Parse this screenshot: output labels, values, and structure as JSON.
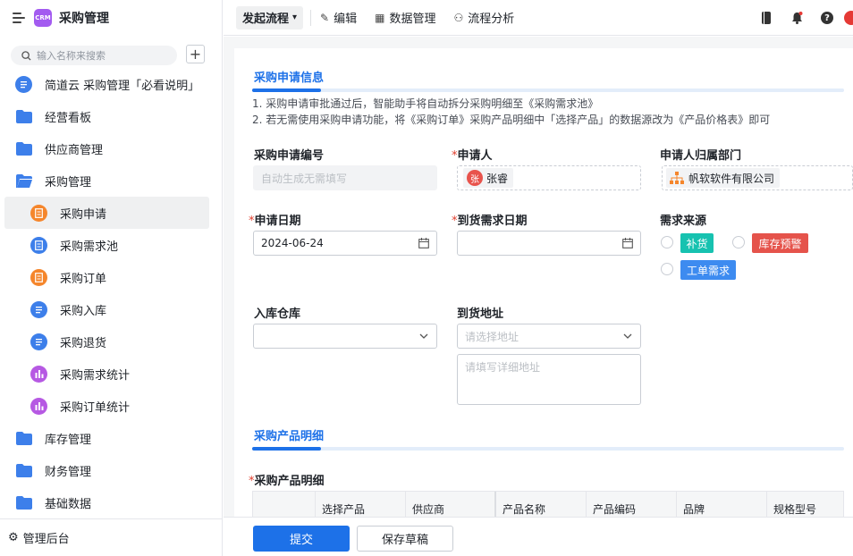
{
  "app": {
    "name": "采购管理",
    "logo_text": "CRM"
  },
  "sidebar": {
    "search_placeholder": "输入名称来搜索",
    "add_label": "+",
    "items": [
      {
        "label": "简道云 采购管理「必看说明」",
        "icon": "doc-icon"
      },
      {
        "label": "经营看板",
        "icon": "folder-icon"
      },
      {
        "label": "供应商管理",
        "icon": "folder-icon"
      },
      {
        "label": "采购管理",
        "icon": "folder-open-icon"
      },
      {
        "label": "采购申请",
        "icon": "form-icon"
      },
      {
        "label": "采购需求池",
        "icon": "form-icon"
      },
      {
        "label": "采购订单",
        "icon": "form-icon"
      },
      {
        "label": "采购入库",
        "icon": "form-icon"
      },
      {
        "label": "采购退货",
        "icon": "form-icon"
      },
      {
        "label": "采购需求统计",
        "icon": "chart-icon"
      },
      {
        "label": "采购订单统计",
        "icon": "chart-icon"
      },
      {
        "label": "库存管理",
        "icon": "folder-icon"
      },
      {
        "label": "财务管理",
        "icon": "folder-icon"
      },
      {
        "label": "基础数据",
        "icon": "folder-icon"
      }
    ],
    "footer": "管理后台"
  },
  "topbar": {
    "flow_button": "发起流程",
    "edit": "编辑",
    "data_manage": "数据管理",
    "flow_analysis": "流程分析"
  },
  "form": {
    "section1_title": "采购申请信息",
    "note1": "1. 采购申请审批通过后，智能助手将自动拆分采购明细至《采购需求池》",
    "note2": "2. 若无需使用采购申请功能，将《采购订单》采购产品明细中「选择产品」的数据源改为《产品价格表》即可",
    "apply_no_label": "采购申请编号",
    "apply_no_placeholder": "自动生成无需填写",
    "applicant_label": "申请人",
    "applicant_name": "张睿",
    "applicant_avatar": "张",
    "dept_label": "申请人归属部门",
    "dept_name": "帆软软件有限公司",
    "apply_date_label": "申请日期",
    "apply_date_value": "2024-06-24",
    "arrive_date_label": "到货需求日期",
    "source_label": "需求来源",
    "source_options": [
      "补货",
      "库存预警",
      "工单需求"
    ],
    "warehouse_label": "入库仓库",
    "address_label": "到货地址",
    "address_placeholder": "请选择地址",
    "address_detail_placeholder": "请填写详细地址",
    "section2_title": "采购产品明细",
    "detail_label": "采购产品明细",
    "columns": [
      "选择产品",
      "供应商",
      "产品名称",
      "产品编码",
      "品牌",
      "规格型号"
    ]
  },
  "footer": {
    "submit": "提交",
    "save_draft": "保存草稿"
  },
  "colors": {
    "primary": "#1d71e8",
    "tag_green": "#17c2b0",
    "tag_red": "#e5534b",
    "tag_blue": "#3d8bf0"
  }
}
